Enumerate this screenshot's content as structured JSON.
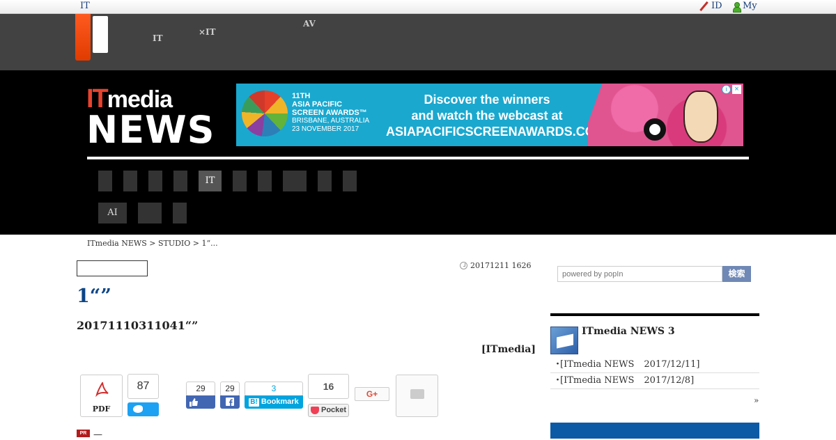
{
  "topbar": {
    "brand": "IT",
    "login": "ID",
    "mypage": "My"
  },
  "nav": {
    "items": [
      {
        "line1": "",
        "line2": "IT"
      },
      {
        "line1": "",
        "line2": "×IT"
      },
      {
        "line1": "AV",
        "line2": ""
      }
    ]
  },
  "masthead": {
    "logo_it": "IT",
    "logo_media": "media",
    "logo_news": "NEWS",
    "ad": {
      "award_line1": "11TH",
      "award_line2": "ASIA PACIFIC",
      "award_line3": "SCREEN AWARDS™",
      "award_line4": "BRISBANE, AUSTRALIA",
      "award_line5": "23 NOVEMBER 2017",
      "message_line1": "Discover the winners",
      "message_line2": "and watch the webcast at",
      "message_line3": "ASIAPACIFICSCREENAWARDS.COM",
      "info": "i",
      "close": "×"
    },
    "categories_row1": [
      "",
      "",
      "",
      "",
      "IT",
      "",
      "",
      "",
      "",
      ""
    ],
    "categories_row2": [
      "AI",
      "",
      ""
    ]
  },
  "article": {
    "breadcrumb": "ITmedia NEWS > STUDIO > 1“...",
    "date": "20171211 1626",
    "title": "1“”",
    "subtitle": "20171110311041“”",
    "byline": "[ITmedia]"
  },
  "share": {
    "pdf_label": "PDF",
    "twitter_count": "87",
    "fb_like_count": "29",
    "fb_share_count": "29",
    "hatena_count": "3",
    "hatena_label": "Bookmark",
    "pocket_count": "16",
    "pocket_label": "Pocket",
    "gplus_label": "G+",
    "pr_label": "PR",
    "pr_text": "—"
  },
  "sidebar": {
    "search_placeholder": "powered by popIn",
    "search_button": "検索",
    "mail_heading": "ITmedia NEWS 3",
    "items": [
      {
        "name": "[ITmedia NEWS",
        "date": "2017/12/11]"
      },
      {
        "name": "[ITmedia NEWS",
        "date": "2017/12/8]"
      }
    ],
    "more": "»"
  },
  "colors": {
    "accent": "#e8432e",
    "title_blue": "#0c4586",
    "twitter": "#1da1f2",
    "facebook": "#4267b2",
    "hatena": "#00a4de",
    "pocket": "#ef4056"
  }
}
